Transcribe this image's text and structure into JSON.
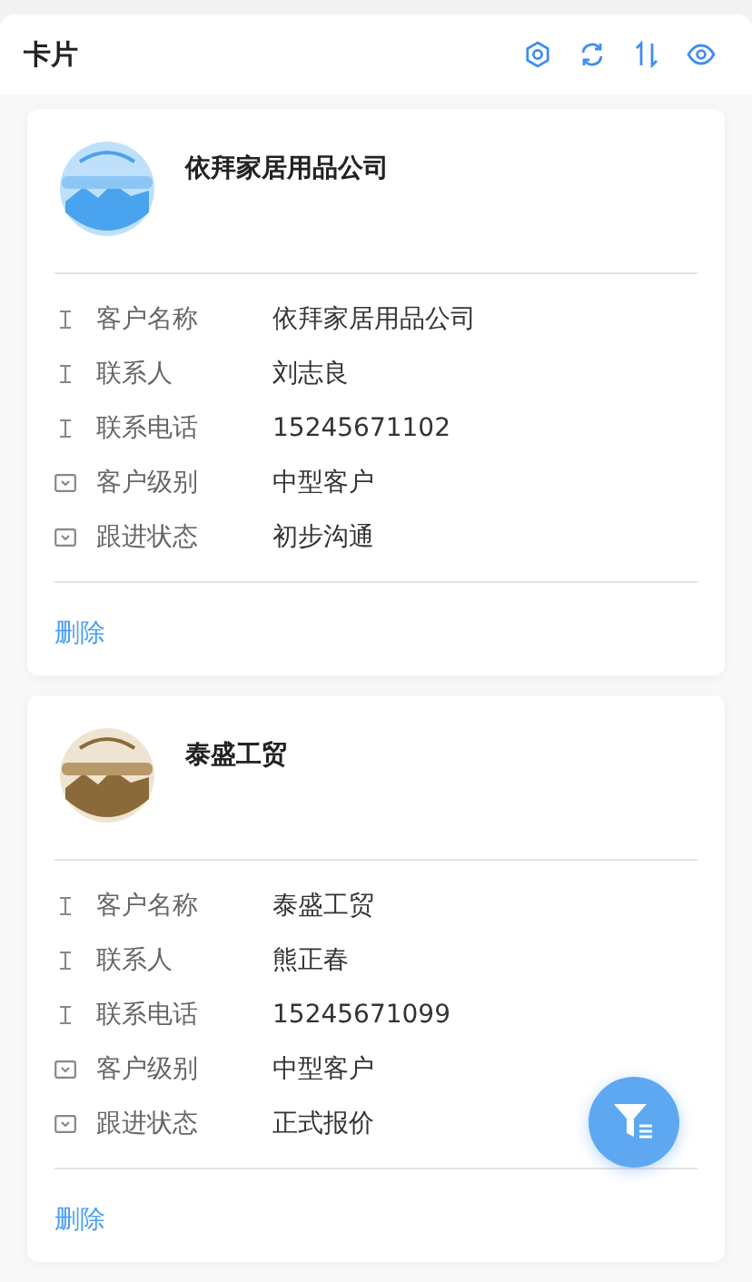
{
  "header": {
    "title": "卡片"
  },
  "cards": [
    {
      "title": "依拜家居用品公司",
      "fields": [
        {
          "kind": "text",
          "label": "客户名称",
          "value": "依拜家居用品公司"
        },
        {
          "kind": "text",
          "label": "联系人",
          "value": "刘志良"
        },
        {
          "kind": "text",
          "label": "联系电话",
          "value": "15245671102"
        },
        {
          "kind": "select",
          "label": "客户级别",
          "value": "中型客户"
        },
        {
          "kind": "select",
          "label": "跟进状态",
          "value": "初步沟通"
        }
      ],
      "action": "删除"
    },
    {
      "title": "泰盛工贸",
      "fields": [
        {
          "kind": "text",
          "label": "客户名称",
          "value": "泰盛工贸"
        },
        {
          "kind": "text",
          "label": "联系人",
          "value": "熊正春"
        },
        {
          "kind": "text",
          "label": "联系电话",
          "value": "15245671099"
        },
        {
          "kind": "select",
          "label": "客户级别",
          "value": "中型客户"
        },
        {
          "kind": "select",
          "label": "跟进状态",
          "value": "正式报价"
        }
      ],
      "action": "删除"
    }
  ]
}
